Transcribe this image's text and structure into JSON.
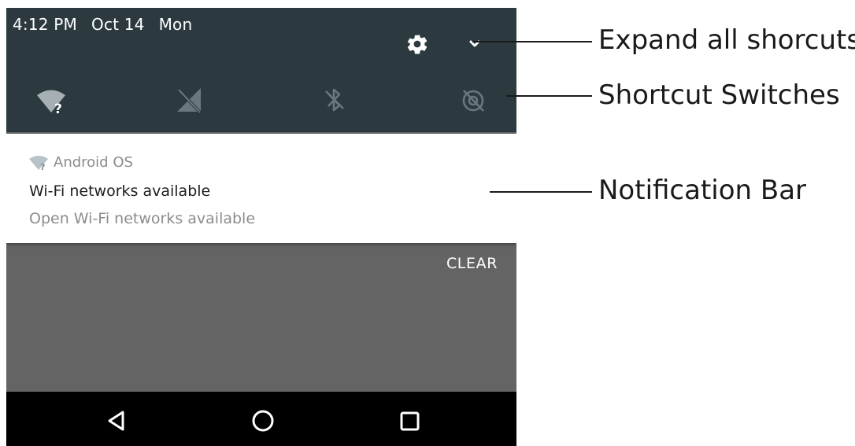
{
  "status_bar": {
    "time": "4:12 PM",
    "date": "Oct 14",
    "day": "Mon"
  },
  "header": {
    "settings_icon": "gear-icon",
    "expand_icon": "chevron-down-icon"
  },
  "quick_settings": [
    {
      "icon": "wifi-unknown-icon"
    },
    {
      "icon": "mobile-data-off-icon"
    },
    {
      "icon": "bluetooth-off-icon"
    },
    {
      "icon": "location-off-icon"
    }
  ],
  "notification": {
    "app_name": "Android OS",
    "title": "Wi-Fi networks available",
    "text": "Open Wi-Fi networks available"
  },
  "clear_label": "CLEAR",
  "nav_bar": [
    "back-icon",
    "home-icon",
    "recents-icon"
  ],
  "callouts": {
    "expand": "Expand all shorcuts",
    "switches": "Shortcut Switches",
    "notification": "Notification Bar"
  },
  "colors": {
    "shade": "#2c3a40",
    "background_scrim": "#646464",
    "nav_bar": "#000000"
  }
}
